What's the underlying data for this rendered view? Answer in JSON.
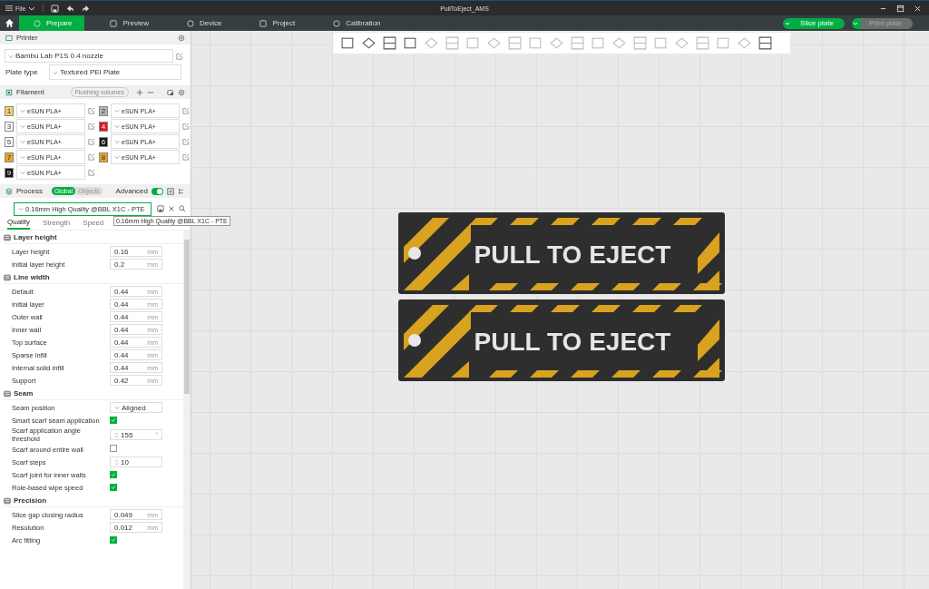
{
  "menu": {
    "label": "File"
  },
  "window": {
    "title": "PullToEject_AMS"
  },
  "tabs": [
    {
      "label": "Prepare",
      "selected": true
    },
    {
      "label": "Preview",
      "selected": false
    },
    {
      "label": "Device",
      "selected": false
    },
    {
      "label": "Project",
      "selected": false
    },
    {
      "label": "Calibration",
      "selected": false
    }
  ],
  "actions": [
    {
      "label": "Slice plate",
      "disabled": false
    },
    {
      "label": "Print plate",
      "disabled": true
    }
  ],
  "printer": {
    "title": "Printer",
    "name": "Bambu Lab P1S 0.4 nozzle",
    "plate_type_label": "Plate type",
    "plate_type": "Textured PEI Plate"
  },
  "filament": {
    "title": "Filament",
    "flushing": "Flushing volumes",
    "slots": [
      {
        "number": "1",
        "color": "#f2d36b",
        "name": "eSUN PLA+"
      },
      {
        "number": "2",
        "color": "#b4b4b4",
        "name": "eSUN PLA+"
      },
      {
        "number": "3",
        "color": "#ffffff",
        "name": "eSUN PLA+"
      },
      {
        "number": "4",
        "color": "#e8131b",
        "name": "eSUN PLA+"
      },
      {
        "number": "5",
        "color": "#ffffff",
        "name": "eSUN PLA+"
      },
      {
        "number": "6",
        "color": "#1a1a1a",
        "name": "eSUN PLA+"
      },
      {
        "number": "7",
        "color": "#e8a524",
        "name": "eSUN PLA+"
      },
      {
        "number": "8",
        "color": "#e8a524",
        "name": "eSUN PLA+"
      },
      {
        "number": "9",
        "color": "#141414",
        "name": "eSUN PLA+"
      }
    ]
  },
  "process": {
    "title": "Process",
    "scope": [
      {
        "label": "Global",
        "selected": true
      },
      {
        "label": "Objects",
        "selected": false
      }
    ],
    "advanced": {
      "label": "Advanced",
      "on": true
    },
    "preset": "0.16mm High Quality @BBL X1C - PTE",
    "tooltip": "0.16mm High Quality @BBL X1C - PTE",
    "tabs": [
      {
        "label": "Quality",
        "selected": true
      },
      {
        "label": "Strength",
        "selected": false
      },
      {
        "label": "Speed",
        "selected": false
      }
    ],
    "sections": [
      {
        "title": "Layer height",
        "rows": [
          {
            "kind": "number",
            "label": "Layer height",
            "value": "0.16",
            "unit": "mm"
          },
          {
            "kind": "number",
            "label": "Initial layer height",
            "value": "0.2",
            "unit": "mm"
          }
        ]
      },
      {
        "title": "Line width",
        "rows": [
          {
            "kind": "number",
            "label": "Default",
            "value": "0.44",
            "unit": "mm"
          },
          {
            "kind": "number",
            "label": "Initial layer",
            "value": "0.44",
            "unit": "mm"
          },
          {
            "kind": "number",
            "label": "Outer wall",
            "value": "0.44",
            "unit": "mm"
          },
          {
            "kind": "number",
            "label": "Inner wall",
            "value": "0.44",
            "unit": "mm"
          },
          {
            "kind": "number",
            "label": "Top surface",
            "value": "0.44",
            "unit": "mm"
          },
          {
            "kind": "number",
            "label": "Sparse infill",
            "value": "0.44",
            "unit": "mm"
          },
          {
            "kind": "number",
            "label": "Internal solid infill",
            "value": "0.44",
            "unit": "mm"
          },
          {
            "kind": "number",
            "label": "Support",
            "value": "0.42",
            "unit": "mm"
          }
        ]
      },
      {
        "title": "Seam",
        "rows": [
          {
            "kind": "select",
            "label": "Seam position",
            "value": "Aligned"
          },
          {
            "kind": "check",
            "label": "Smart scarf seam application",
            "checked": true
          },
          {
            "kind": "spin",
            "label": "Scarf application angle threshold",
            "value": "155",
            "unit": "°"
          },
          {
            "kind": "check",
            "label": "Scarf around entire wall",
            "checked": false
          },
          {
            "kind": "spin",
            "label": "Scarf steps",
            "value": "10"
          },
          {
            "kind": "check",
            "label": "Scarf joint for inner walls",
            "checked": true
          },
          {
            "kind": "check",
            "label": "Role-based wipe speed",
            "checked": true
          }
        ]
      },
      {
        "title": "Precision",
        "rows": [
          {
            "kind": "number",
            "label": "Slice gap closing radius",
            "value": "0.049",
            "unit": "mm"
          },
          {
            "kind": "number",
            "label": "Resolution",
            "value": "0.012",
            "unit": "mm"
          },
          {
            "kind": "check",
            "label": "Arc fitting",
            "checked": true
          }
        ]
      }
    ]
  },
  "models": [
    {
      "text": "PULL TO EJECT"
    },
    {
      "text": "PULL TO EJECT"
    }
  ]
}
